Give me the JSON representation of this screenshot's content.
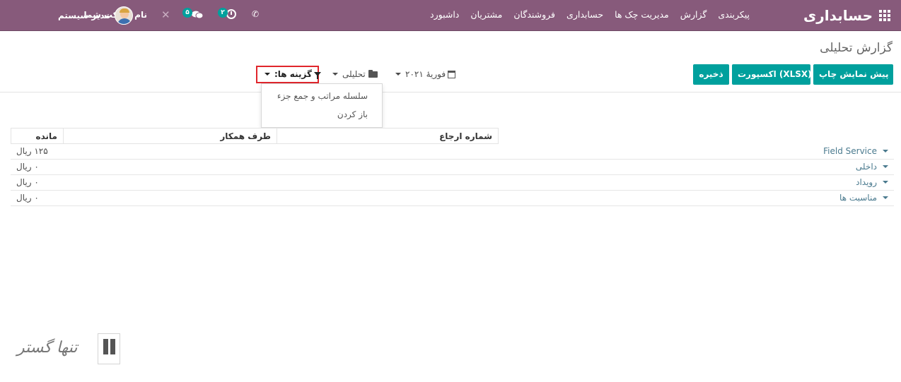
{
  "navbar": {
    "brand": "حسابداری",
    "menu": [
      "داشبورد",
      "مشتریان",
      "فروشندگان",
      "حسابداری",
      "مدیریت چک ها",
      "گزارش",
      "پیکربندی"
    ],
    "user_name": "مدیر سیستم",
    "company": "نام شرکت شما",
    "messages_count": "۵",
    "activities_count": "۲"
  },
  "page": {
    "title": "گزارش تحلیلی"
  },
  "toolbar": {
    "print_label": "پیش نمایش چاپ",
    "export_label": "اکسپورت (XLSX)",
    "save_label": "ذخیره",
    "date_filter": "فوریهٔ ۲۰۲۱",
    "analytic_filter": "تحلیلی",
    "options_filter": "گزینه ها:"
  },
  "options_dropdown": {
    "items": [
      "سلسله مراتب و جمع جزء",
      "باز کردن"
    ]
  },
  "table": {
    "headers": {
      "reference": "شماره ارجاع",
      "partner": "طرف همکار",
      "balance": "مانده"
    },
    "rows": [
      {
        "label": "Field Service",
        "balance": "۱۲۵ ریال"
      },
      {
        "label": "داخلی",
        "balance": "۰ ریال"
      },
      {
        "label": "رویداد",
        "balance": "۰ ریال"
      },
      {
        "label": "مناسبت ها",
        "balance": "۰ ریال"
      }
    ]
  },
  "watermark": {
    "text": "تنها گستر"
  },
  "colors": {
    "navbar": "#875a7b",
    "accent": "#00a09d",
    "highlight": "#e0262c",
    "row_label": "#4a7a8e"
  }
}
